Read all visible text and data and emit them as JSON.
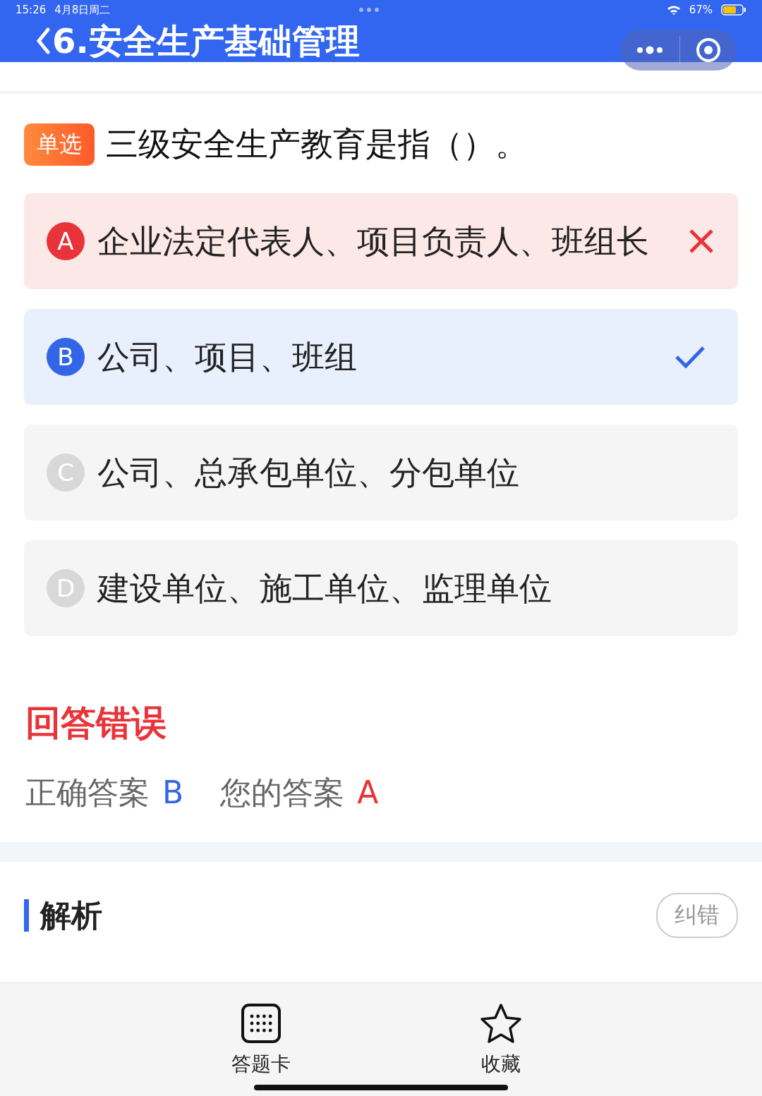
{
  "status_bar": {
    "time": "15:26",
    "date": "4月8日周二",
    "battery": "67%"
  },
  "header": {
    "title": "6.安全生产基础管理"
  },
  "question": {
    "type_tag": "单选",
    "text": "三级安全生产教育是指（）。"
  },
  "options": [
    {
      "letter": "A",
      "text": "企业法定代表人、项目负责人、班组长",
      "kind": "wrong"
    },
    {
      "letter": "B",
      "text": "公司、项目、班组",
      "kind": "correct"
    },
    {
      "letter": "C",
      "text": "公司、总承包单位、分包单位",
      "kind": "normal"
    },
    {
      "letter": "D",
      "text": "建设单位、施工单位、监理单位",
      "kind": "normal"
    }
  ],
  "result": {
    "title": "回答错误",
    "correct_label": "正确答案",
    "correct_value": "B",
    "your_label": "您的答案",
    "your_value": "A"
  },
  "analysis": {
    "title": "解析",
    "report_button": "纠错"
  },
  "bottom_bar": [
    {
      "label": "答题卡",
      "kind": "grid"
    },
    {
      "label": "收藏",
      "kind": "star"
    }
  ]
}
